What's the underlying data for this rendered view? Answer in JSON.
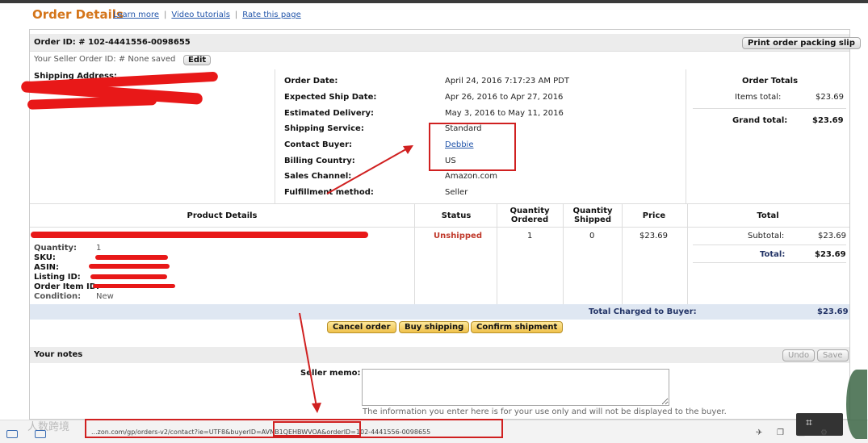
{
  "header": {
    "title": "Order Details",
    "links": [
      "Learn more",
      "Video tutorials",
      "Rate this page"
    ]
  },
  "order": {
    "id_label": "Order ID: # 102-4441556-0098655",
    "print_label": "Print order packing slip",
    "seller_order_id": "Your Seller Order ID: # None saved",
    "edit_label": "Edit",
    "shipping_address_label": "Shipping Address:"
  },
  "info": {
    "rows": [
      {
        "label": "Order Date:",
        "value": "April 24, 2016 7:17:23 AM PDT"
      },
      {
        "label": "Expected Ship Date:",
        "value": "Apr 26, 2016 to Apr 27, 2016"
      },
      {
        "label": "Estimated Delivery:",
        "value": "May 3, 2016 to May 11, 2016"
      },
      {
        "label": "Shipping Service:",
        "value": "Standard"
      },
      {
        "label": "Contact Buyer:",
        "value": "Debbie"
      },
      {
        "label": "Billing Country:",
        "value": "US"
      },
      {
        "label": "Sales Channel:",
        "value": "Amazon.com"
      },
      {
        "label": "Fulfillment method:",
        "value": "Seller"
      }
    ]
  },
  "totals": {
    "title": "Order Totals",
    "items_label": "Items total:",
    "items_value": "$23.69",
    "grand_label": "Grand total:",
    "grand_value": "$23.69"
  },
  "product_table": {
    "headers": [
      "Product Details",
      "Status",
      "Quantity Ordered",
      "Quantity Shipped",
      "Price",
      "Total"
    ],
    "detail_labels": [
      "Quantity:",
      "SKU:",
      "ASIN:",
      "Listing ID:",
      "Order Item ID:",
      "Condition:"
    ],
    "quantity": "1",
    "condition": "New",
    "status": "Unshipped",
    "qty_ordered": "1",
    "qty_shipped": "0",
    "price": "$23.69",
    "subtotal_label": "Subtotal:",
    "subtotal_value": "$23.69",
    "total_label": "Total:",
    "total_value": "$23.69",
    "charged_label": "Total Charged to Buyer:",
    "charged_value": "$23.69"
  },
  "actions": {
    "cancel": "Cancel order",
    "buy_shipping": "Buy shipping",
    "confirm": "Confirm shipment"
  },
  "notes": {
    "title": "Your notes",
    "undo": "Undo",
    "save": "Save",
    "memo_label": "Seller memo:",
    "memo_help": "The information you enter here is for your use only and will not be displayed to the buyer."
  },
  "statusbar": {
    "url": "...zon.com/gp/orders-v2/contact?ie=UTF8&buyerID=AVNB1QEHBWVOA&orderID=102-4441556-0098655",
    "watermark": "人数跨境"
  },
  "colors": {
    "accent": "#d4751a",
    "status_red": "#c0392b",
    "annotation_red": "#d02020",
    "link": "#2255aa"
  }
}
